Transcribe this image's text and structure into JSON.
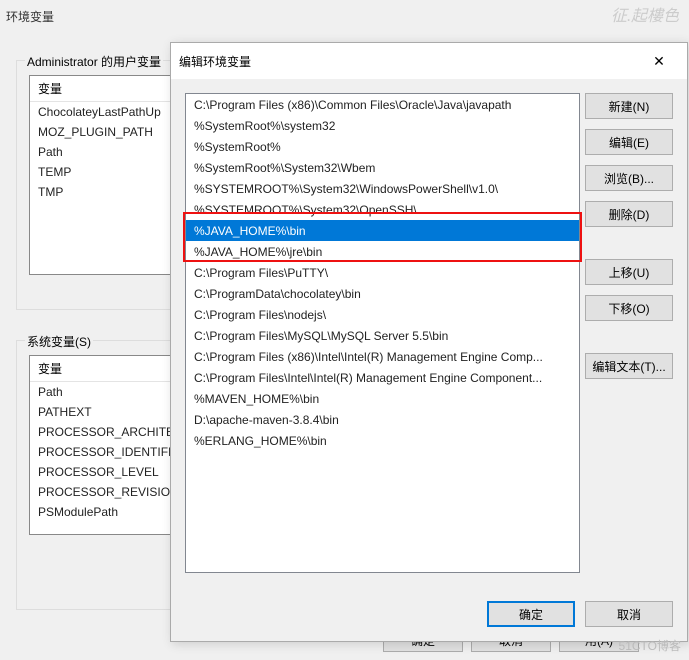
{
  "bg": {
    "title": "环境变量",
    "user_group_label": "Administrator 的用户变量",
    "system_group_label": "系统变量(S)",
    "col_header": "变量",
    "user_vars": [
      "ChocolateyLastPathUp",
      "MOZ_PLUGIN_PATH",
      "Path",
      "TEMP",
      "TMP"
    ],
    "system_vars": [
      "变量",
      "Path",
      "PATHEXT",
      "PROCESSOR_ARCHITE",
      "PROCESSOR_IDENTIFI",
      "PROCESSOR_LEVEL",
      "PROCESSOR_REVISION",
      "PSModulePath"
    ],
    "ok": "确定",
    "cancel": "取消",
    "apply": "用(A)"
  },
  "fg": {
    "title": "编辑环境变量",
    "items": [
      "C:\\Program Files (x86)\\Common Files\\Oracle\\Java\\javapath",
      "%SystemRoot%\\system32",
      "%SystemRoot%",
      "%SystemRoot%\\System32\\Wbem",
      "%SYSTEMROOT%\\System32\\WindowsPowerShell\\v1.0\\",
      "%SYSTEMROOT%\\System32\\OpenSSH\\",
      "%JAVA_HOME%\\bin",
      "%JAVA_HOME%\\jre\\bin",
      "C:\\Program Files\\PuTTY\\",
      "C:\\ProgramData\\chocolatey\\bin",
      "C:\\Program Files\\nodejs\\",
      "C:\\Program Files\\MySQL\\MySQL Server 5.5\\bin",
      "C:\\Program Files (x86)\\Intel\\Intel(R) Management Engine Comp...",
      "C:\\Program Files\\Intel\\Intel(R) Management Engine Component...",
      "%MAVEN_HOME%\\bin",
      "D:\\apache-maven-3.8.4\\bin",
      "%ERLANG_HOME%\\bin"
    ],
    "selected_index": 6,
    "btn_new": "新建(N)",
    "btn_edit": "编辑(E)",
    "btn_browse": "浏览(B)...",
    "btn_delete": "删除(D)",
    "btn_up": "上移(U)",
    "btn_down": "下移(O)",
    "btn_edit_text": "编辑文本(T)...",
    "ok": "确定",
    "cancel": "取消"
  },
  "watermark_top": "征.起樓色",
  "watermark_bottom": "51CTO博客"
}
